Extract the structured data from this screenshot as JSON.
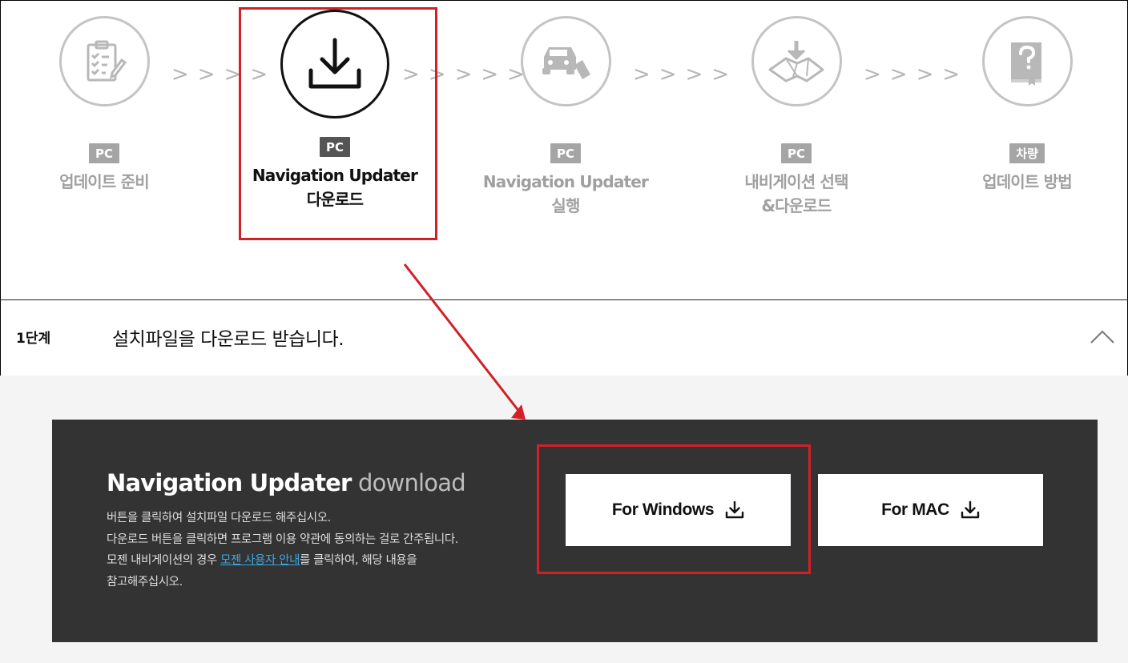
{
  "steps": [
    {
      "badge": "PC",
      "label_line1": "업데이트 준비",
      "label_line2": "",
      "icon": "clipboard-checklist-icon",
      "active": false
    },
    {
      "badge": "PC",
      "label_line1": "Navigation Updater",
      "label_line2": "다운로드",
      "icon": "download-icon",
      "active": true
    },
    {
      "badge": "PC",
      "label_line1": "Navigation Updater",
      "label_line2": "실행",
      "icon": "car-usb-icon",
      "active": false
    },
    {
      "badge": "PC",
      "label_line1": "내비게이션 선택",
      "label_line2": "&다운로드",
      "icon": "map-download-icon",
      "active": false
    },
    {
      "badge": "차량",
      "label_line1": "업데이트 방법",
      "label_line2": "",
      "icon": "manual-book-icon",
      "active": false
    }
  ],
  "stage": {
    "label": "1단계",
    "title": "설치파일을 다운로드 받습니다."
  },
  "panel": {
    "title_strong": "Navigation Updater",
    "title_light": "download",
    "desc_line1": "버튼을 클릭하여 설치파일 다운로드 해주십시오.",
    "desc_line2": "다운로드 버튼을 클릭하면 프로그램 이용 약관에 동의하는 걸로 간주됩니다.",
    "desc_line3_pre": "모젠 내비게이션의 경우 ",
    "desc_link": "모젠 사용자 안내",
    "desc_line3_post": "를 클릭하여, 해당 내용을",
    "desc_line4": "참고해주십시오.",
    "btn_windows": "For Windows",
    "btn_mac": "For MAC"
  },
  "colors": {
    "highlight": "#d22027",
    "panel_bg": "#333333",
    "link": "#3aa7e2",
    "inactive": "#a0a0a0"
  }
}
